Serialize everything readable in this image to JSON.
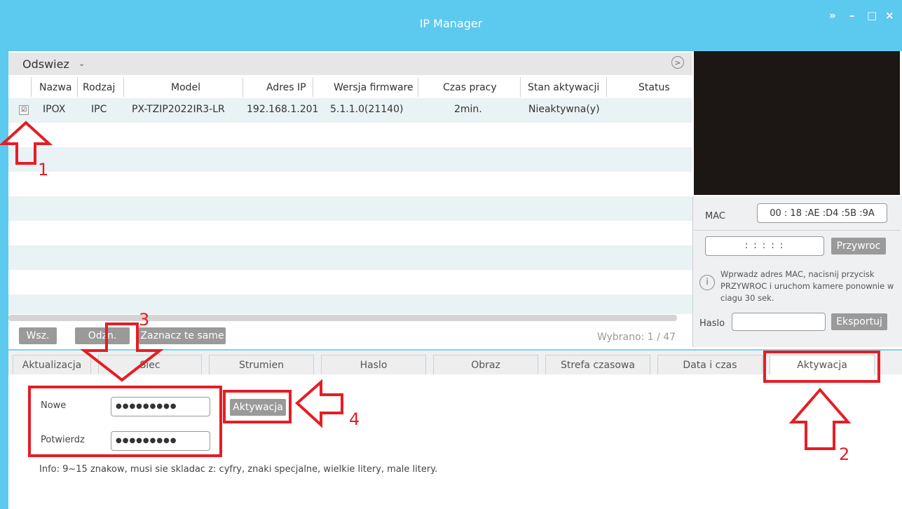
{
  "window": {
    "title": "IP Manager",
    "controls": [
      "»",
      "–",
      "□",
      "×"
    ]
  },
  "toolbar": {
    "refresh_label": "Odswiez",
    "refresh_chevron": "⌄"
  },
  "table": {
    "columns": [
      "Nazwa",
      "Rodzaj",
      "Model",
      "Adres IP",
      "Wersja firmware",
      "Czas pracy",
      "Stan aktywacji",
      "Status"
    ],
    "rows": [
      {
        "checked": "☑",
        "nazwa": "IPOX",
        "rodzaj": "IPC",
        "model": "PX-TZIP2022IR3-LR",
        "ip": "192.168.1.201",
        "firmware": "5.1.1.0(21140)",
        "czas": "2min.",
        "stan": "Nieaktywna(y)",
        "status": ""
      }
    ]
  },
  "bottom_buttons": {
    "all": "Wsz.",
    "deselect": "Odzn.",
    "same": "Zaznacz te same"
  },
  "selection": {
    "label": "Wybrano: 1  / 47"
  },
  "right_panel": {
    "mac_label": "MAC",
    "mac_value": "00 : 18 :AE :D4 :5B :9A",
    "mac_input": ":  :  :  :  :",
    "restore_button": "Przywroc",
    "info_text": "Wprwadz adres MAC, nacisnij przycisk PRZYWROC i uruchom kamere ponownie w ciagu 30 sek.",
    "haslo_label": "Haslo",
    "export_button": "Eksportuj"
  },
  "tabs": [
    "Aktualizacja",
    "Siec",
    "Strumien",
    "Haslo",
    "Obraz",
    "Strefa czasowa",
    "Data i czas",
    "Aktywacja"
  ],
  "activation": {
    "new_label": "Nowe",
    "new_value": "●●●●●●●●●",
    "confirm_label": "Potwierdz",
    "confirm_value": "●●●●●●●●●",
    "activate_button": "Aktywacja",
    "info": "Info: 9~15 znakow, musi sie skladac z: cyfry, znaki specjalne, wielkie litery, male litery."
  },
  "annotations": {
    "n1": "1",
    "n2": "2",
    "n3": "3",
    "n4": "4",
    "annotation_color": "#e41e25"
  },
  "colors": {
    "titlebar": "#5cc9ef",
    "row_alt": "#e9f2f4",
    "button_gray": "#9a9a9a"
  }
}
